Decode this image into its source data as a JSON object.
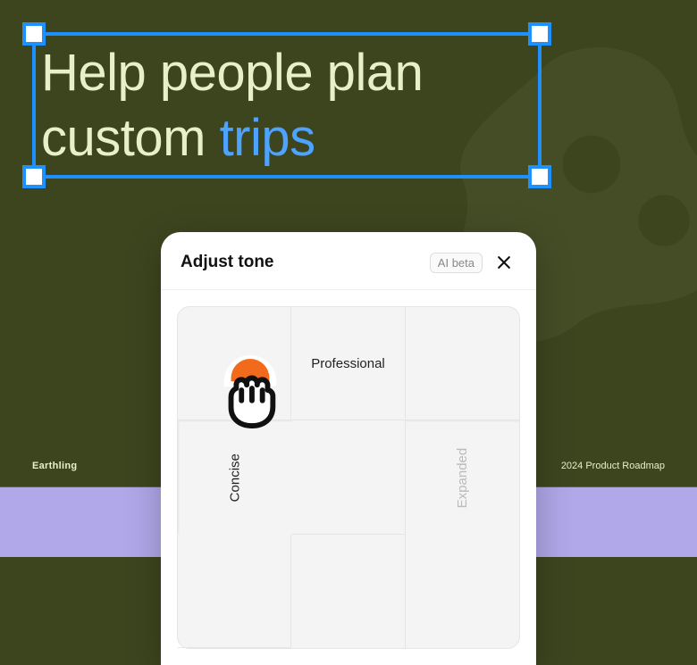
{
  "headline": {
    "line1": "Help people plan",
    "line2_prefix": "custom ",
    "line2_accent": "trips"
  },
  "footer": {
    "brand": "Earthling",
    "right": "2024 Product Roadmap"
  },
  "panel": {
    "title": "Adjust tone",
    "badge": "AI beta",
    "labels": {
      "top": "Professional",
      "left": "Concise",
      "right": "Expanded"
    }
  }
}
